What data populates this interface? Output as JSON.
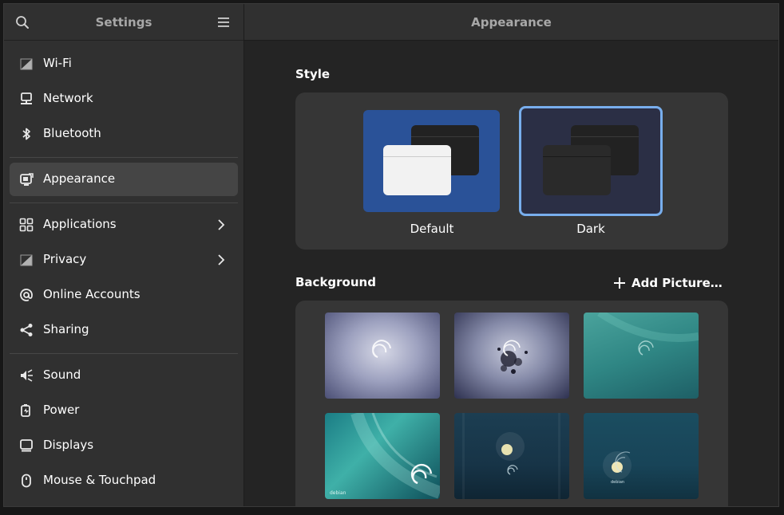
{
  "sidebar": {
    "title": "Settings",
    "items": [
      {
        "label": "Wi-Fi",
        "icon": "wifi-icon"
      },
      {
        "label": "Network",
        "icon": "network-icon"
      },
      {
        "label": "Bluetooth",
        "icon": "bluetooth-icon"
      },
      {
        "label": "Appearance",
        "icon": "appearance-icon",
        "selected": true
      },
      {
        "label": "Applications",
        "icon": "applications-icon",
        "has_submenu": true
      },
      {
        "label": "Privacy",
        "icon": "privacy-icon",
        "has_submenu": true
      },
      {
        "label": "Online Accounts",
        "icon": "at-icon"
      },
      {
        "label": "Sharing",
        "icon": "share-icon"
      },
      {
        "label": "Sound",
        "icon": "sound-icon"
      },
      {
        "label": "Power",
        "icon": "power-icon"
      },
      {
        "label": "Displays",
        "icon": "display-icon"
      },
      {
        "label": "Mouse & Touchpad",
        "icon": "mouse-icon"
      }
    ]
  },
  "content": {
    "title": "Appearance",
    "style": {
      "heading": "Style",
      "options": [
        {
          "label": "Default",
          "selected": false
        },
        {
          "label": "Dark",
          "selected": true
        }
      ]
    },
    "background": {
      "heading": "Background",
      "add_label": "Add Picture…",
      "wallpapers": [
        {
          "name": "debian-swirl-light"
        },
        {
          "name": "debian-splatter"
        },
        {
          "name": "debian-teal-swirl"
        },
        {
          "name": "debian-teal-wave"
        },
        {
          "name": "debian-moonlight"
        },
        {
          "name": "debian-moon-swirl"
        }
      ],
      "wallpaper_watermark": "debian"
    }
  },
  "colors": {
    "accent": "#78aeed",
    "default_style_bg": "#2a5298"
  }
}
